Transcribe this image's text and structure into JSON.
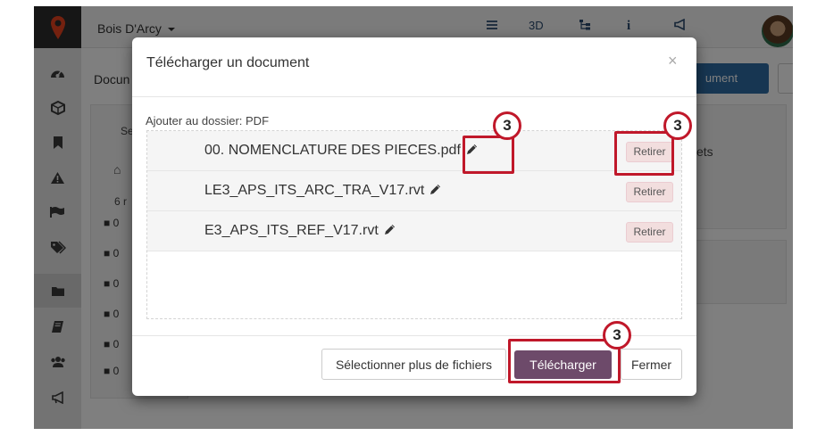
{
  "topbar": {
    "project_title": "Bois D'Arcy",
    "icons": [
      "list-icon",
      "3d-view-icon",
      "tree-icon",
      "info-icon",
      "announcement-icon"
    ],
    "label_3d": "3D"
  },
  "sidebar": {
    "icons": [
      "dashboard-icon",
      "cube-icon",
      "bookmark-icon",
      "warning-icon",
      "flag-icon",
      "tags-icon",
      "folder-icon",
      "book-icon",
      "users-icon",
      "megaphone-icon"
    ]
  },
  "background": {
    "doc_title_partial": "Docun",
    "primary_button_partial": "ument",
    "more_button": "⋮",
    "partial_text_1": "Se",
    "partial_text_2": "6 r",
    "partial_text_3": "ets",
    "folder_rows": [
      "0",
      "0",
      "0",
      "0",
      "0",
      "0"
    ]
  },
  "modal": {
    "title": "Télécharger un document",
    "close": "×",
    "folder_label": "Ajouter au dossier: PDF",
    "files": [
      {
        "name": "00. NOMENCLATURE DES PIECES.pdf",
        "remove": "Retirer"
      },
      {
        "name": "LE3_APS_ITS_ARC_TRA_V17.rvt",
        "remove": "Retirer"
      },
      {
        "name": "E3_APS_ITS_REF_V17.rvt",
        "remove": "Retirer"
      }
    ],
    "buttons": {
      "more_files": "Sélectionner plus de fichiers",
      "upload": "Télécharger",
      "close": "Fermer"
    }
  },
  "annotations": {
    "badges": [
      "3",
      "3",
      "3"
    ],
    "highlight_color": "#c0182a"
  },
  "colors": {
    "upload_button": "#6d4a6a",
    "remove_button_bg": "#f2dede",
    "primary_blue": "#2e6da4"
  }
}
